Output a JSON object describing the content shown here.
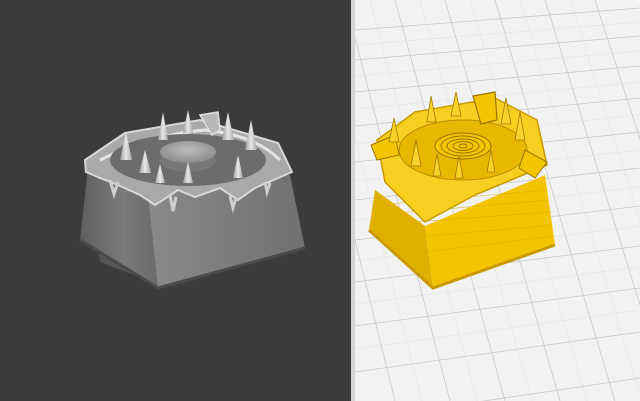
{
  "app": {
    "views": [
      {
        "id": "sculpt-view",
        "viewport_background": "#3b3b3b",
        "model_color": "#8c8c8c",
        "render_style": "shaded-grey"
      },
      {
        "id": "slicer-view",
        "viewport_background": "#f2f2f2",
        "model_color": "#f5c400",
        "render_style": "sliced-toolpath",
        "grid_color": "#c8c8c8"
      }
    ],
    "model": {
      "object": "keycap",
      "features": [
        "spike-ring",
        "center-disc",
        "dripping-rim"
      ]
    }
  }
}
